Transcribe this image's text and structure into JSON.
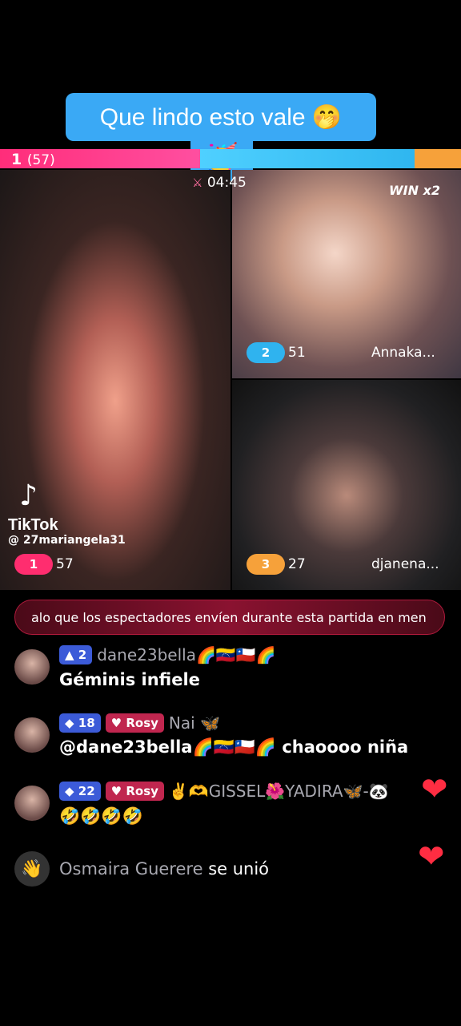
{
  "caption": {
    "text": "Que lindo esto vale 🤭",
    "emoji": "🥳"
  },
  "battle": {
    "left_rank": "1",
    "left_score": "(57)",
    "timer": "04:45",
    "win_label": "WIN x2"
  },
  "hosts": [
    {
      "rank": "1",
      "score": "57",
      "name": ""
    },
    {
      "rank": "2",
      "score": "51",
      "name": "Annaka..."
    },
    {
      "rank": "3",
      "score": "27",
      "name": "djanena..."
    }
  ],
  "watermark": {
    "brand": "TikTok",
    "user": "@ 27mariangela31"
  },
  "banner": {
    "text": "alo que los espectadores envíen durante esta partida en men"
  },
  "comments": [
    {
      "level": "2",
      "badge": "",
      "username": "dane23bella🌈🇻🇪🇨🇱🌈",
      "message": "Géminis infiele"
    },
    {
      "level": "18",
      "badge": "Rosy",
      "username": "Nai 🦋",
      "message": "@dane23bella🌈🇻🇪🇨🇱🌈 chaoooo niña"
    },
    {
      "level": "22",
      "badge": "Rosy",
      "username": "✌️🫶GISSEL🌺YADIRA🦋-🐼",
      "message": "🤣🤣🤣🤣"
    }
  ],
  "joined": {
    "name": "Osmaira Guerere",
    "action": "se unió"
  },
  "hearts": [
    "❤",
    "❤"
  ]
}
